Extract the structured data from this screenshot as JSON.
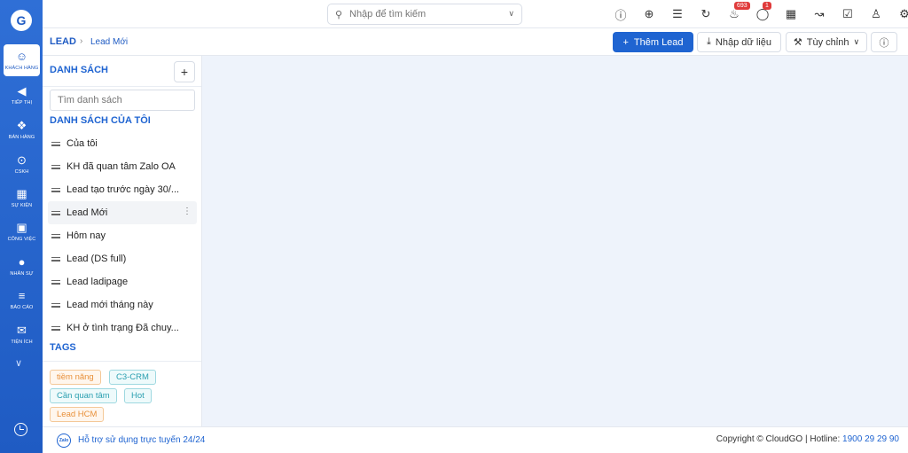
{
  "app": {
    "logo_letter": "G"
  },
  "rail": {
    "items": [
      {
        "label": "KHÁCH HÀNG",
        "icon": "users-icon",
        "glyph": "☺"
      },
      {
        "label": "TIẾP THỊ",
        "icon": "megaphone-icon",
        "glyph": "◀"
      },
      {
        "label": "BÁN HÀNG",
        "icon": "cart-icon",
        "glyph": "❖"
      },
      {
        "label": "CSKH",
        "icon": "lifebuoy-icon",
        "glyph": "⊙"
      },
      {
        "label": "SỰ KIỆN",
        "icon": "calendar-icon",
        "glyph": "▦"
      },
      {
        "label": "CÔNG VIỆC",
        "icon": "briefcase-icon",
        "glyph": "▣"
      },
      {
        "label": "NHÂN SỰ",
        "icon": "person-icon",
        "glyph": "●"
      },
      {
        "label": "BÁO CÁO",
        "icon": "report-icon",
        "glyph": "≡"
      },
      {
        "label": "TIỆN ÍCH",
        "icon": "box-icon",
        "glyph": "✉"
      }
    ]
  },
  "topbar": {
    "search_placeholder": "Nhập để tìm kiếm",
    "notifications_count": "693",
    "messages_count": "1"
  },
  "breadcrumb": {
    "root": "LEAD",
    "current": "Lead Mới"
  },
  "toolbar": {
    "add_label": "Thêm Lead",
    "import_label": "Nhập dữ liệu",
    "custom_label": "Tùy chỉnh"
  },
  "panel": {
    "title": "DANH SÁCH",
    "search_placeholder": "Tìm danh sách",
    "my_lists_title": "DANH SÁCH CỦA TÔI",
    "items": [
      "Của tôi",
      "KH đã quan tâm Zalo OA",
      "Lead tạo trước ngày 30/...",
      "Lead Mới",
      "Hôm nay",
      "Lead (DS full)",
      "Lead ladipage",
      "Lead mới tháng này",
      "KH ở tình trạng Đã chuy..."
    ],
    "active_item": "Lead Mới",
    "tags_title": "TAGS",
    "tags": [
      "tiềm năng",
      "C3-CRM",
      "Cần quan tâm",
      "Hot",
      "Lead HCM"
    ]
  },
  "footer": {
    "zalo_badge": "Zalo",
    "support": "Hỗ trợ sử dụng trực tuyến 24/24",
    "copyright": "Copyright © CloudGO | Hotline: ",
    "hotline": "1900 29 29 90"
  },
  "colors": {
    "primary": "#1f64d1",
    "tag_orange": "#e8903a",
    "tag_cyan": "#2a9fb0",
    "badge_red": "#e03b3b"
  }
}
